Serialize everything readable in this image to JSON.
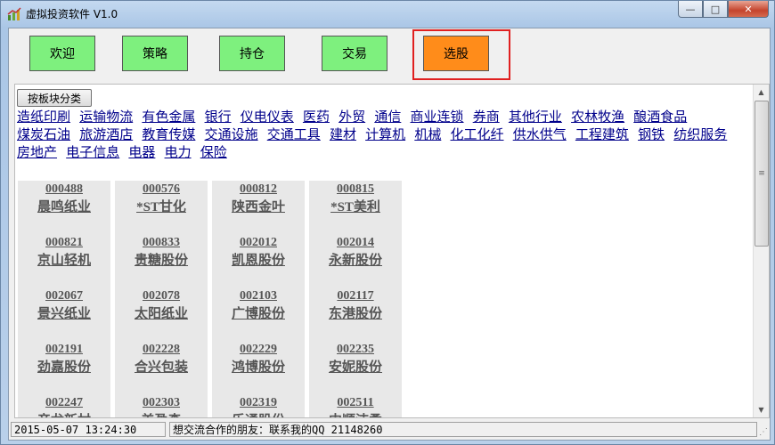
{
  "window": {
    "title": "虚拟投资软件 V1.0",
    "min": "—",
    "max": "□",
    "close": "✕"
  },
  "nav": [
    {
      "label": "欢迎"
    },
    {
      "label": "策略"
    },
    {
      "label": "持仓"
    },
    {
      "label": "交易"
    },
    {
      "label": "选股",
      "active": true
    }
  ],
  "category_button": "按板块分类",
  "categories": [
    "造纸印刷",
    "运输物流",
    "有色金属",
    "银行",
    "仪电仪表",
    "医药",
    "外贸",
    "通信",
    "商业连锁",
    "券商",
    "其他行业",
    "农林牧渔",
    "酿酒食品",
    "煤炭石油",
    "旅游酒店",
    "教育传媒",
    "交通设施",
    "交通工具",
    "建材",
    "计算机",
    "机械",
    "化工化纤",
    "供水供气",
    "工程建筑",
    "钢铁",
    "纺织服务",
    "房地产",
    "电子信息",
    "电器",
    "电力",
    "保险"
  ],
  "stocks": [
    {
      "code": "000488",
      "name": "晨鸣纸业"
    },
    {
      "code": "000576",
      "name": "*ST甘化"
    },
    {
      "code": "000812",
      "name": "陕西金叶"
    },
    {
      "code": "000815",
      "name": "*ST美利"
    },
    {
      "code": "000821",
      "name": "京山轻机"
    },
    {
      "code": "000833",
      "name": "贵糖股份"
    },
    {
      "code": "002012",
      "name": "凯恩股份"
    },
    {
      "code": "002014",
      "name": "永新股份"
    },
    {
      "code": "002067",
      "name": "景兴纸业"
    },
    {
      "code": "002078",
      "name": "太阳纸业"
    },
    {
      "code": "002103",
      "name": "广博股份"
    },
    {
      "code": "002117",
      "name": "东港股份"
    },
    {
      "code": "002191",
      "name": "劲嘉股份"
    },
    {
      "code": "002228",
      "name": "合兴包装"
    },
    {
      "code": "002229",
      "name": "鸿博股份"
    },
    {
      "code": "002235",
      "name": "安妮股份"
    },
    {
      "code": "002247",
      "name": "帝龙新材"
    },
    {
      "code": "002303",
      "name": "美盈森"
    },
    {
      "code": "002319",
      "name": "乐通股份"
    },
    {
      "code": "002511",
      "name": "中顺洁柔"
    }
  ],
  "status": {
    "datetime": "2015-05-07 13:24:30",
    "message": "想交流合作的朋友：联系我的QQ 21148260"
  },
  "colors": {
    "nav_button": "#7ef07e",
    "nav_active": "#ff8c1a",
    "highlight_frame": "#e02020",
    "link": "#00008b"
  }
}
